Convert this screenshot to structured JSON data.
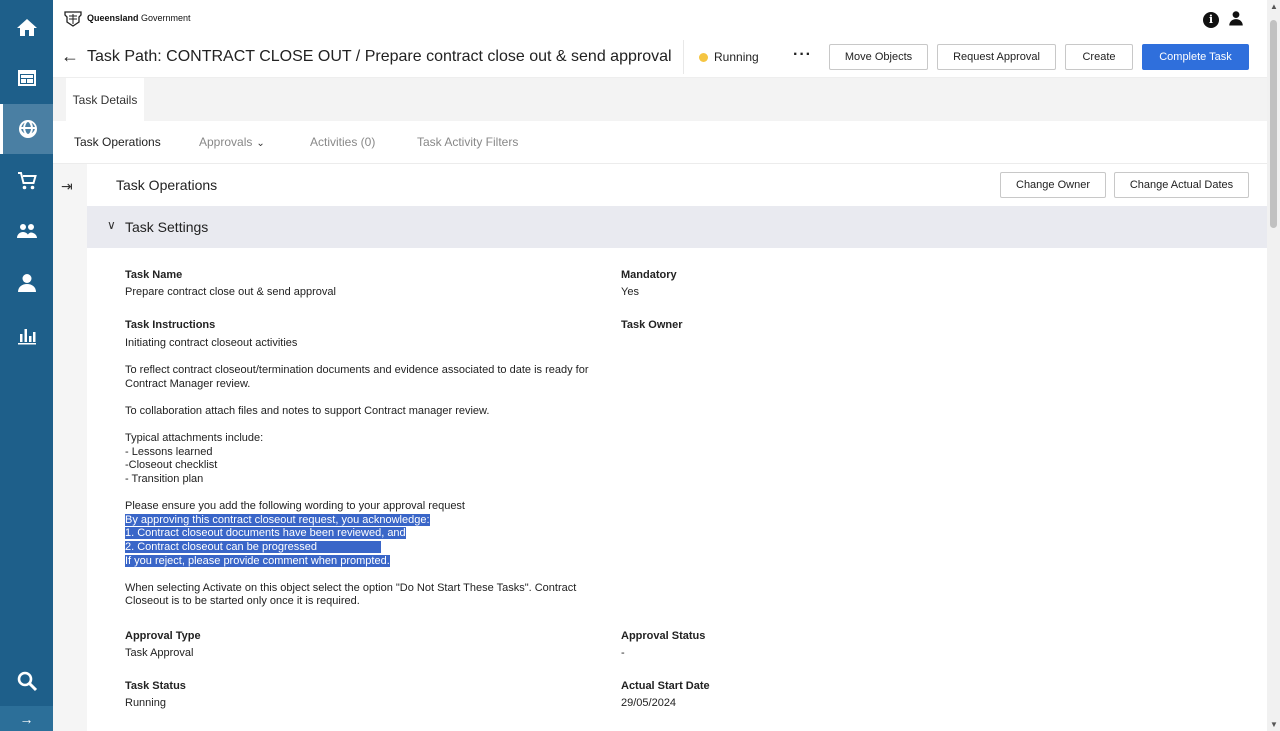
{
  "brand": {
    "name_bold": "Queensland",
    "name_rest": " Government"
  },
  "rail": {
    "expand_glyph": "→",
    "icons": [
      "home-icon",
      "dashboard-icon",
      "globe-network-icon",
      "cart-icon",
      "people-icon",
      "user-icon",
      "bar-chart-icon",
      "search-icon"
    ]
  },
  "header": {
    "back_glyph": "←",
    "title": "Task Path: CONTRACT CLOSE OUT / Prepare contract close out & send approval",
    "status": "Running",
    "more": "···",
    "buttons": {
      "move_objects": "Move Objects",
      "request_approval": "Request Approval",
      "create": "Create",
      "complete_task": "Complete Task"
    }
  },
  "band": {
    "tab": "Task Details"
  },
  "subtabs": {
    "task_operations": "Task Operations",
    "approvals": "Approvals",
    "activities": "Activities (0)",
    "filters": "Task Activity Filters"
  },
  "ops": {
    "title": "Task Operations",
    "change_owner": "Change Owner",
    "change_dates": "Change Actual Dates"
  },
  "settings": {
    "title": "Task Settings",
    "task_name_label": "Task Name",
    "task_name": "Prepare contract close out & send approval",
    "mandatory_label": "Mandatory",
    "mandatory": "Yes",
    "instructions_label": "Task Instructions",
    "owner_label": "Task Owner",
    "instructions": {
      "p1": "Initiating contract closeout activities",
      "p2": "To reflect contract closeout/termination documents and evidence associated to date is ready for Contract Manager review.",
      "p3": "To collaboration attach files and notes to support Contract manager review.",
      "p4_l1": "Typical attachments include:",
      "p4_l2": "- Lessons learned",
      "p4_l3": "-Closeout checklist",
      "p4_l4": "- Transition plan",
      "p5_l1": "Please ensure you add the following wording to your approval request",
      "p5_l2": "By approving this contract closeout request, you acknowledge:",
      "p5_l3": "1. Contract closeout documents have been reviewed, and",
      "p5_l4": "2. Contract closeout can be progressed",
      "p5_l5": "If you reject, please provide comment when prompted.",
      "p6": "When selecting Activate on this object select the option \"Do Not Start These Tasks\". Contract Closeout is to be started only once it is required."
    },
    "approval_type_label": "Approval Type",
    "approval_type": "Task Approval",
    "approval_status_label": "Approval Status",
    "approval_status": "-",
    "task_status_label": "Task Status",
    "task_status": "Running",
    "actual_start_label": "Actual Start Date",
    "actual_start": "29/05/2024"
  },
  "colors": {
    "rail": "#1e5f8a",
    "primary": "#2f6fdc",
    "status_running": "#f5c542",
    "highlight": "#3a66c8"
  }
}
